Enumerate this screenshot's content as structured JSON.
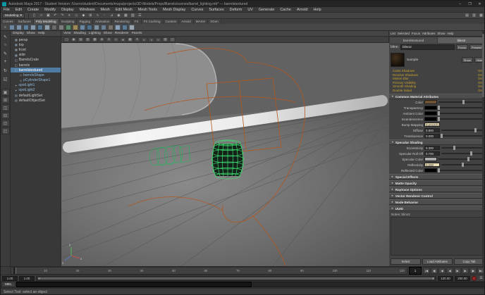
{
  "window": {
    "title": "Autodesk Maya 2017 - Student Version: /Users/student/Documents/maya/projects/3D Models/Props/Barrels/scenes/barrel_lighting.mb* --- barrelstextured",
    "minimize": "–",
    "maximize": "❐",
    "close": "✕"
  },
  "menubar": {
    "items": [
      "File",
      "Edit",
      "Create",
      "Modify",
      "Display",
      "Windows",
      "Mesh",
      "Edit Mesh",
      "Mesh Tools",
      "Mesh Display",
      "Curves",
      "Surfaces",
      "Deform",
      "UV",
      "Generate",
      "Cache",
      "Arnold",
      "Help"
    ]
  },
  "statusline": {
    "menuset": "Modeling",
    "menuset_arrow": "▾",
    "icons": [
      {
        "name": "new-scene-icon",
        "glyph": "▯"
      },
      {
        "name": "open-scene-icon",
        "glyph": "▱"
      },
      {
        "name": "save-scene-icon",
        "glyph": "▣"
      },
      {
        "name": "undo-icon",
        "glyph": "↶"
      },
      {
        "name": "redo-icon",
        "glyph": "↷"
      },
      {
        "name": "select-by-hierarchy-icon",
        "glyph": "≡"
      },
      {
        "name": "select-by-object-icon",
        "glyph": "◇"
      },
      {
        "name": "select-by-component-icon",
        "glyph": "◆"
      },
      {
        "name": "snap-to-grid-icon",
        "glyph": "⊞"
      },
      {
        "name": "snap-to-curve-icon",
        "glyph": "∿"
      },
      {
        "name": "snap-to-point-icon",
        "glyph": "◦"
      },
      {
        "name": "snap-to-plane-icon",
        "glyph": "⊿"
      },
      {
        "name": "make-live-icon",
        "glyph": "◉"
      },
      {
        "name": "render-frame-icon",
        "glyph": "▦"
      },
      {
        "name": "ipr-render-icon",
        "glyph": "▧"
      },
      {
        "name": "render-settings-icon",
        "glyph": "☰"
      }
    ],
    "sidebar_toggles": [
      {
        "name": "attribute-editor-toggle",
        "glyph": "▤"
      },
      {
        "name": "tool-settings-toggle",
        "glyph": "▥"
      },
      {
        "name": "channel-box-toggle",
        "glyph": "▦"
      }
    ]
  },
  "shelf": {
    "menu_glyph": "≡",
    "tabs": [
      {
        "label": "Curves"
      },
      {
        "label": "Surfaces"
      },
      {
        "label": "Poly Modeling",
        "cls": "active"
      },
      {
        "label": "Sculpting"
      },
      {
        "label": "Rigging"
      },
      {
        "label": "Animation"
      },
      {
        "label": "Rendering"
      },
      {
        "label": "FX"
      },
      {
        "label": "FX Caching"
      },
      {
        "label": "Custom"
      },
      {
        "label": "Arnold"
      },
      {
        "label": "MASH"
      },
      {
        "label": "XGen"
      }
    ],
    "icons": [
      {
        "name": "shelf-sphere-icon",
        "color": "#6e87a0"
      },
      {
        "name": "shelf-cube-icon",
        "color": "#7b8fa5"
      },
      {
        "name": "shelf-cylinder-icon",
        "color": "#60809c"
      },
      {
        "name": "shelf-cone-icon",
        "color": "#8598a9"
      },
      {
        "name": "shelf-torus-icon",
        "color": "#55748e"
      },
      {
        "name": "shelf-plane-icon",
        "color": "#90a0ad"
      },
      {
        "name": "shelf-disc-icon",
        "color": "#6a6a6a"
      },
      {
        "name": "shelf-platonic-icon",
        "color": "#7d7d7d"
      },
      {
        "name": "shelf-helix-icon",
        "color": "#5c8a6e"
      },
      {
        "name": "shelf-pipe-icon",
        "color": "#9c8a5a"
      },
      {
        "name": "shelf-prism-icon",
        "color": "#6e87a0"
      },
      {
        "name": "shelf-pyramid-icon",
        "color": "#4f6e88"
      },
      {
        "name": "shelf-soccerball-icon",
        "color": "#808f9c"
      },
      {
        "name": "shelf-superellipse-icon",
        "color": "#6b7f93"
      },
      {
        "name": "shelf-text-icon",
        "color": "#77716a"
      },
      {
        "name": "shelf-bevel-icon",
        "color": "#8aa0b4"
      },
      {
        "name": "shelf-boolean-icon",
        "color": "#5d7a94"
      },
      {
        "name": "shelf-combine-icon",
        "color": "#9aa7b2"
      }
    ]
  },
  "toolbox": {
    "tools": [
      {
        "name": "select-tool-icon",
        "glyph": "↖"
      },
      {
        "name": "lasso-tool-icon",
        "glyph": "○"
      },
      {
        "name": "paint-select-tool-icon",
        "glyph": "✎"
      },
      {
        "name": "move-tool-icon",
        "glyph": "+"
      },
      {
        "name": "rotate-tool-icon",
        "glyph": "↻"
      },
      {
        "name": "scale-tool-icon",
        "glyph": "◱"
      }
    ],
    "layouts": [
      {
        "name": "single-pane-layout-button",
        "glyph": "▣"
      },
      {
        "name": "four-pane-layout-button",
        "glyph": "⊞"
      },
      {
        "name": "persp-outliner-layout-button",
        "glyph": "◫"
      },
      {
        "name": "persp-graph-layout-button",
        "glyph": "⊟"
      },
      {
        "name": "hypershade-persp-layout-button",
        "glyph": "⊡"
      },
      {
        "name": "uv-persp-layout-button",
        "glyph": "◰"
      }
    ]
  },
  "outliner": {
    "menus": [
      "Display",
      "Show",
      "Help"
    ],
    "items": [
      {
        "icon": "▦",
        "label": "persp"
      },
      {
        "icon": "▦",
        "label": "top"
      },
      {
        "icon": "▦",
        "label": "front"
      },
      {
        "icon": "▦",
        "label": "side"
      },
      {
        "icon": "◫",
        "label": "BarrelsCrate"
      },
      {
        "icon": "◫",
        "label": "barrels"
      },
      {
        "icon": "◫",
        "label": "barrelstextured",
        "cls": "selected"
      },
      {
        "icon": "◇",
        "label": "barrelsShape",
        "cls": "blue indent"
      },
      {
        "icon": "◇",
        "label": "pCylinderShape1",
        "cls": "blue indent"
      },
      {
        "icon": "✦",
        "label": "spotLight1",
        "cls": "blue"
      },
      {
        "icon": "✦",
        "label": "spotLight2",
        "cls": "blue"
      },
      {
        "icon": "▤",
        "label": "defaultLightSet"
      },
      {
        "icon": "▤",
        "label": "defaultObjectSet"
      }
    ]
  },
  "viewport": {
    "menus": [
      "View",
      "Shading",
      "Lighting",
      "Show",
      "Renderer",
      "Panels"
    ],
    "toolbar_icons": [
      {
        "name": "select-camera-icon",
        "glyph": "▢"
      },
      {
        "name": "lock-camera-icon",
        "glyph": "◉"
      },
      {
        "name": "camera-attributes-icon",
        "glyph": "▤"
      },
      {
        "name": "bookmarks-icon",
        "glyph": "▥"
      },
      {
        "name": "image-plane-icon",
        "glyph": "▦"
      },
      {
        "name": "two-d-pan-zoom-icon",
        "glyph": "⊕"
      },
      {
        "name": "oversampling-icon",
        "glyph": "≋"
      },
      {
        "name": "wireframe-icon",
        "glyph": "◇"
      },
      {
        "name": "smooth-shade-icon",
        "glyph": "●"
      },
      {
        "name": "textured-icon",
        "glyph": "▩"
      },
      {
        "name": "use-all-lights-icon",
        "glyph": "☀"
      },
      {
        "name": "shadows-icon",
        "glyph": "◐"
      },
      {
        "name": "screen-space-ao-icon",
        "glyph": "◑"
      },
      {
        "name": "motion-blur-icon",
        "glyph": "≈"
      },
      {
        "name": "multisample-icon",
        "glyph": "▨"
      },
      {
        "name": "gate-mask-icon",
        "glyph": "◫"
      }
    ],
    "colors": {
      "wire_green": "#3fe173",
      "wire_green_dark": "#28b45f",
      "curve_orange": "#b3571e"
    },
    "axis": {
      "x": "x",
      "y": "y",
      "z": "z"
    }
  },
  "attribute_editor": {
    "menus": [
      "List",
      "Selected",
      "Focus",
      "Attributes",
      "Show",
      "Help"
    ],
    "tabs": [
      {
        "label": "barrelstextured"
      },
      {
        "label": "blinn2",
        "cls": "active"
      }
    ],
    "node_type_label": "blinn:",
    "node_name": "blinn2",
    "btn_focus": "Focus",
    "btn_presets": "Presets*",
    "btn_show": "Show",
    "btn_hide": "Hide",
    "sample_label": "Sample",
    "stats": [
      {
        "label": "Casts Shadows",
        "value": "On"
      },
      {
        "label": "Receive Shadows",
        "value": "On"
      },
      {
        "label": "Motion Blur",
        "value": "On"
      },
      {
        "label": "Primary Visibility",
        "value": "On"
      },
      {
        "label": "Smooth Shading",
        "value": "On"
      },
      {
        "label": "Double Sided",
        "value": "On"
      }
    ],
    "sections": [
      {
        "title": "Common Material Attributes",
        "rows": [
          {
            "label": "Color",
            "swatch": "#6b5334",
            "slider": 0.55
          },
          {
            "label": "Transparency",
            "swatch": "#000000",
            "slider": 0
          },
          {
            "label": "Ambient Color",
            "swatch": "#000000",
            "slider": 0
          },
          {
            "label": "Incandescence",
            "swatch": "#000000",
            "slider": 0
          },
          {
            "label": "Bump Mapping",
            "value": "bump2d1",
            "textured": true
          },
          {
            "label": "Diffuse",
            "value": "0.800",
            "slider": 0.8
          },
          {
            "label": "Translucence",
            "value": "0.000",
            "slider": 0
          }
        ]
      },
      {
        "title": "Specular Shading",
        "rows": [
          {
            "label": "Eccentricity",
            "value": "0.300",
            "slider": 0.3
          },
          {
            "label": "Specular Roll Off",
            "value": "0.700",
            "slider": 0.7
          },
          {
            "label": "Specular Color",
            "swatch": "#aaaaaa",
            "slider": 0.65
          },
          {
            "label": "Reflectivity",
            "value": "0.500",
            "slider": 0.5,
            "textured": true
          },
          {
            "label": "Reflected Color",
            "swatch": "#000000",
            "slider": 0
          }
        ]
      },
      {
        "title": "Special Effects",
        "collapsed": true
      },
      {
        "title": "Matte Opacity",
        "collapsed": true
      },
      {
        "title": "Raytrace Options",
        "collapsed": true
      },
      {
        "title": "Vector Renderer Control",
        "collapsed": true
      },
      {
        "title": "Node Behavior",
        "collapsed": true
      },
      {
        "title": "UUID",
        "collapsed": true
      }
    ],
    "notes_label": "Notes: blinn2",
    "buttons": [
      "Select",
      "Load Attributes",
      "Copy Tab"
    ]
  },
  "timeline": {
    "ticks": [
      "1",
      "10",
      "20",
      "30",
      "40",
      "50",
      "60",
      "70",
      "80",
      "90",
      "100",
      "110",
      "120"
    ],
    "current_frame": "1",
    "playback": [
      {
        "name": "go-to-start-button",
        "glyph": "|◀"
      },
      {
        "name": "step-back-key-button",
        "glyph": "◀|"
      },
      {
        "name": "step-back-frame-button",
        "glyph": "◀"
      },
      {
        "name": "play-backwards-button",
        "glyph": "◀"
      },
      {
        "name": "play-forward-button",
        "glyph": "▶"
      },
      {
        "name": "step-forward-frame-button",
        "glyph": "▶"
      },
      {
        "name": "step-forward-key-button",
        "glyph": "|▶"
      },
      {
        "name": "go-to-end-button",
        "glyph": "▶|"
      }
    ],
    "range": {
      "anim_start": "1.00",
      "play_start": "1.00",
      "play_end": "120.00",
      "anim_end": "200.00"
    },
    "prefs_glyph": "☰"
  },
  "command_line": {
    "label": "MEL",
    "input_value": "",
    "output": ""
  },
  "help_line": {
    "text": "Select Tool: select an object"
  }
}
